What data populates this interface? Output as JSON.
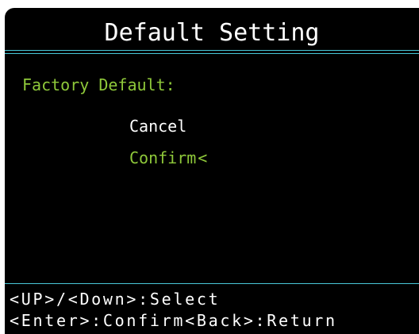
{
  "screen": {
    "title": "Default Setting",
    "heading": "Factory Default:",
    "options": [
      {
        "label": "Cancel",
        "selected": false
      },
      {
        "label": "Confirm",
        "selected": true
      }
    ],
    "cursor": "<",
    "help": [
      "<UP>/<Down>:Select",
      "<Enter>:Confirm<Back>:Return"
    ]
  },
  "colors": {
    "background": "#000000",
    "text": "#ffffff",
    "highlight": "#8fc93a",
    "divider": "#48c8d8"
  }
}
